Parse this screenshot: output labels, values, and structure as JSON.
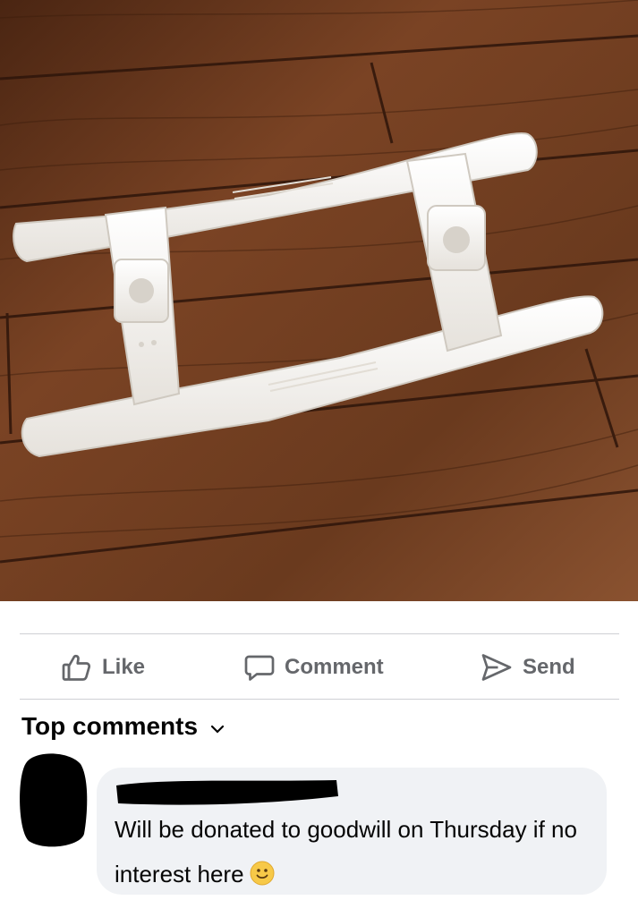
{
  "post": {
    "photo_alt": "white plastic rocker base on wood floor"
  },
  "actions": {
    "like_label": "Like",
    "comment_label": "Comment",
    "send_label": "Send"
  },
  "comments": {
    "sort_label": "Top comments",
    "items": [
      {
        "text": "Will be donated to goodwill on Thursday if no interest here",
        "emoji": "slightly-smiling-face"
      }
    ]
  },
  "colors": {
    "action_gray": "#65676b",
    "bubble_bg": "#f0f2f5",
    "divider": "#ced0d4",
    "floor_wood": "#6b3a1f",
    "plastic_white": "#f4f1ec"
  }
}
